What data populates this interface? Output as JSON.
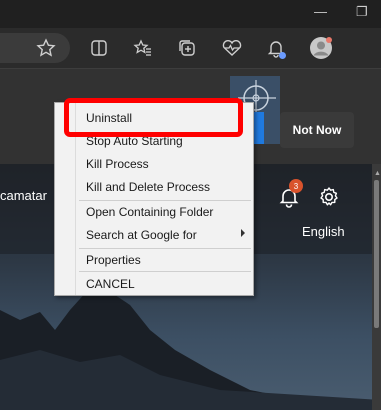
{
  "window_controls": {
    "minimize_glyph": "—",
    "restore_glyph": "❐"
  },
  "toolbar_icons": [
    "favorite-star-icon",
    "split-screen-icon",
    "favorites-icon",
    "collections-icon",
    "browser-essentials-icon",
    "notifications-icon",
    "profile-avatar-icon"
  ],
  "infobar": {
    "not_now_label": "Not Now"
  },
  "page": {
    "location_text": "camatar",
    "notification_count": "3",
    "language_label": "English"
  },
  "context_menu": {
    "items": [
      {
        "label": "Uninstall"
      },
      {
        "label": "Stop Auto Starting"
      },
      {
        "label": "Kill Process"
      },
      {
        "label": "Kill and Delete Process"
      },
      {
        "label": "Open Containing Folder"
      },
      {
        "label": "Search at Google for",
        "has_submenu": true
      },
      {
        "label": "Properties"
      },
      {
        "label": "CANCEL"
      }
    ]
  },
  "colors": {
    "highlight_box": "#ff0000",
    "badge_orange": "#d9532c",
    "accent_blue": "#1f7ae0"
  }
}
